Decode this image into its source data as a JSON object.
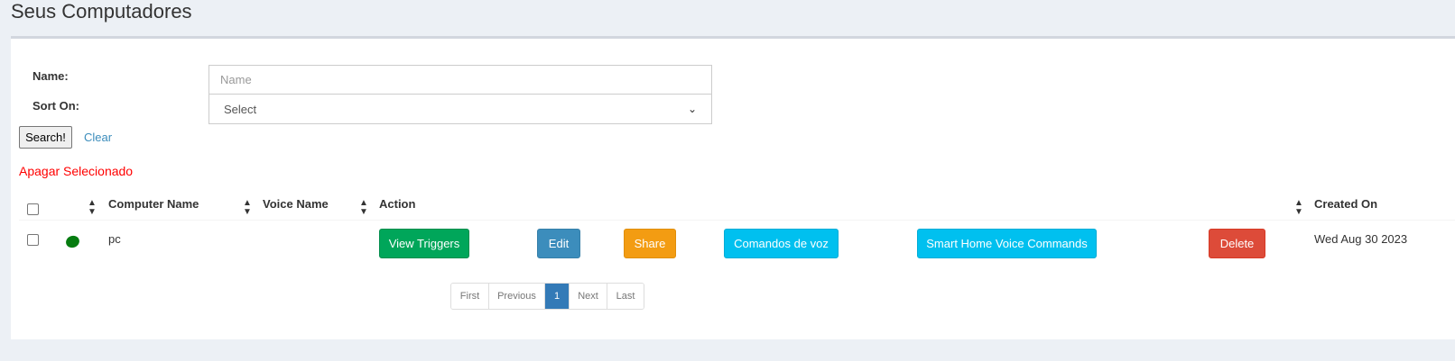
{
  "page": {
    "title": "Seus Computadores"
  },
  "filters": {
    "name_label": "Name:",
    "name_placeholder": "Name",
    "sort_label": "Sort On:",
    "sort_value": "Select",
    "search_label": "Search!",
    "clear_label": "Clear"
  },
  "bulk": {
    "delete_selected": "Apagar Selecionado"
  },
  "table": {
    "headers": {
      "computer_name": "Computer Name",
      "voice_name": "Voice Name",
      "action": "Action",
      "created_on": "Created On"
    },
    "rows": [
      {
        "status_color": "#067c10",
        "computer_name": "pc",
        "voice_name": "",
        "actions": {
          "view_triggers": "View Triggers",
          "edit": "Edit",
          "share": "Share",
          "voice_commands": "Comandos de voz",
          "smart_home": "Smart Home Voice Commands",
          "delete": "Delete"
        },
        "created_on": "Wed Aug 30 2023"
      }
    ]
  },
  "pagination": {
    "first": "First",
    "previous": "Previous",
    "current": "1",
    "next": "Next",
    "last": "Last"
  },
  "colors": {
    "view_triggers": "#00a65a",
    "edit": "#3c8dbc",
    "share": "#f39c12",
    "voice": "#00c0ef",
    "delete": "#dd4b39"
  }
}
